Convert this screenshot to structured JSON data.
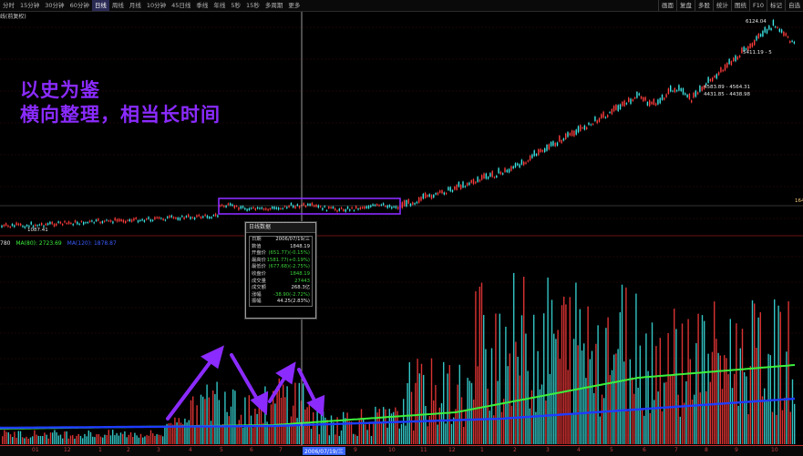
{
  "toolbar": {
    "tabs": [
      "分时",
      "15分钟",
      "30分钟",
      "60分钟",
      "日线",
      "周线",
      "月线",
      "10分钟",
      "45日线",
      "季线",
      "年线",
      "5秒",
      "15秒",
      "多周期",
      "更多"
    ],
    "active_tab": "日线",
    "right_tabs": [
      "画面",
      "复盘",
      "多股",
      "统计",
      "图统",
      "F10",
      "标记",
      "自选"
    ]
  },
  "legend_top": "线(前复权)",
  "legend_vol": {
    "prefix": "780",
    "ma1": "MA(80): 2723.69",
    "ma2": "MA(120): 1878.87"
  },
  "overlay_text": {
    "line1": "以史为鉴",
    "line2": "横向整理，相当长时间"
  },
  "price_labels": {
    "high": "6124.04",
    "low_left": "1087.41",
    "range1": "5411.19 - 5",
    "range2": "4583.89 - 4564.31",
    "range3": "4431.85 - 4438.98",
    "right_edge": "164"
  },
  "tooltip": {
    "title": "日线数据",
    "rows": [
      {
        "k": "日期",
        "v": "2006/07/19/三",
        "c": ""
      },
      {
        "k": "数值",
        "v": "1848.19",
        "c": ""
      },
      {
        "k": "开盘价",
        "v": "(651.77)(-0.15%)",
        "c": "g"
      },
      {
        "k": "最高价",
        "v": "1581.77(+0.19%)",
        "c": "g"
      },
      {
        "k": "最低价",
        "v": "(677.68)(-2.75%)",
        "c": "g"
      },
      {
        "k": "收盘价",
        "v": "1848.19",
        "c": "g"
      },
      {
        "k": "成交量",
        "v": "27443",
        "c": "g"
      },
      {
        "k": "成交额",
        "v": "268.3亿",
        "c": ""
      },
      {
        "k": "涨幅",
        "v": "-38.90(-2.72%)",
        "c": "g"
      },
      {
        "k": "振幅",
        "v": "44.25(2.83%)",
        "c": ""
      }
    ]
  },
  "x_axis": {
    "labels": [
      "01",
      "12",
      "1",
      "2",
      "3",
      "4",
      "5",
      "6",
      "7",
      "2006/07/19/三",
      "9",
      "10",
      "11",
      "12",
      "1",
      "2",
      "3",
      "4",
      "5",
      "6",
      "7",
      "8",
      "9",
      "10"
    ],
    "cursor_label": "2006/07/19/三"
  },
  "colors": {
    "up": "#ff3c3c",
    "down": "#3ce6e6",
    "ma_green": "#3cf03c",
    "ma_blue": "#1e3cff",
    "annotation": "#8b2bff"
  }
}
